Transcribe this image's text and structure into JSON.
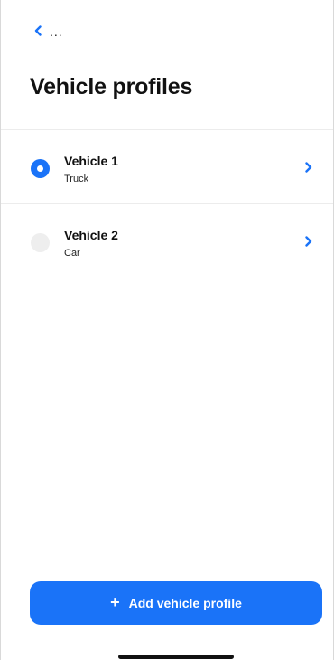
{
  "header": {
    "back_label": "...",
    "title": "Vehicle profiles"
  },
  "vehicles": [
    {
      "name": "Vehicle 1",
      "type": "Truck",
      "selected": true
    },
    {
      "name": "Vehicle 2",
      "type": "Car",
      "selected": false
    }
  ],
  "actions": {
    "add_plus": "+",
    "add_label": "Add vehicle profile"
  },
  "colors": {
    "accent": "#1a73f8",
    "radio_unselected": "#eeeeee",
    "divider": "#ececec"
  },
  "icons": {
    "back": "chevron-left-icon",
    "row": "chevron-right-icon",
    "add": "plus-icon"
  }
}
